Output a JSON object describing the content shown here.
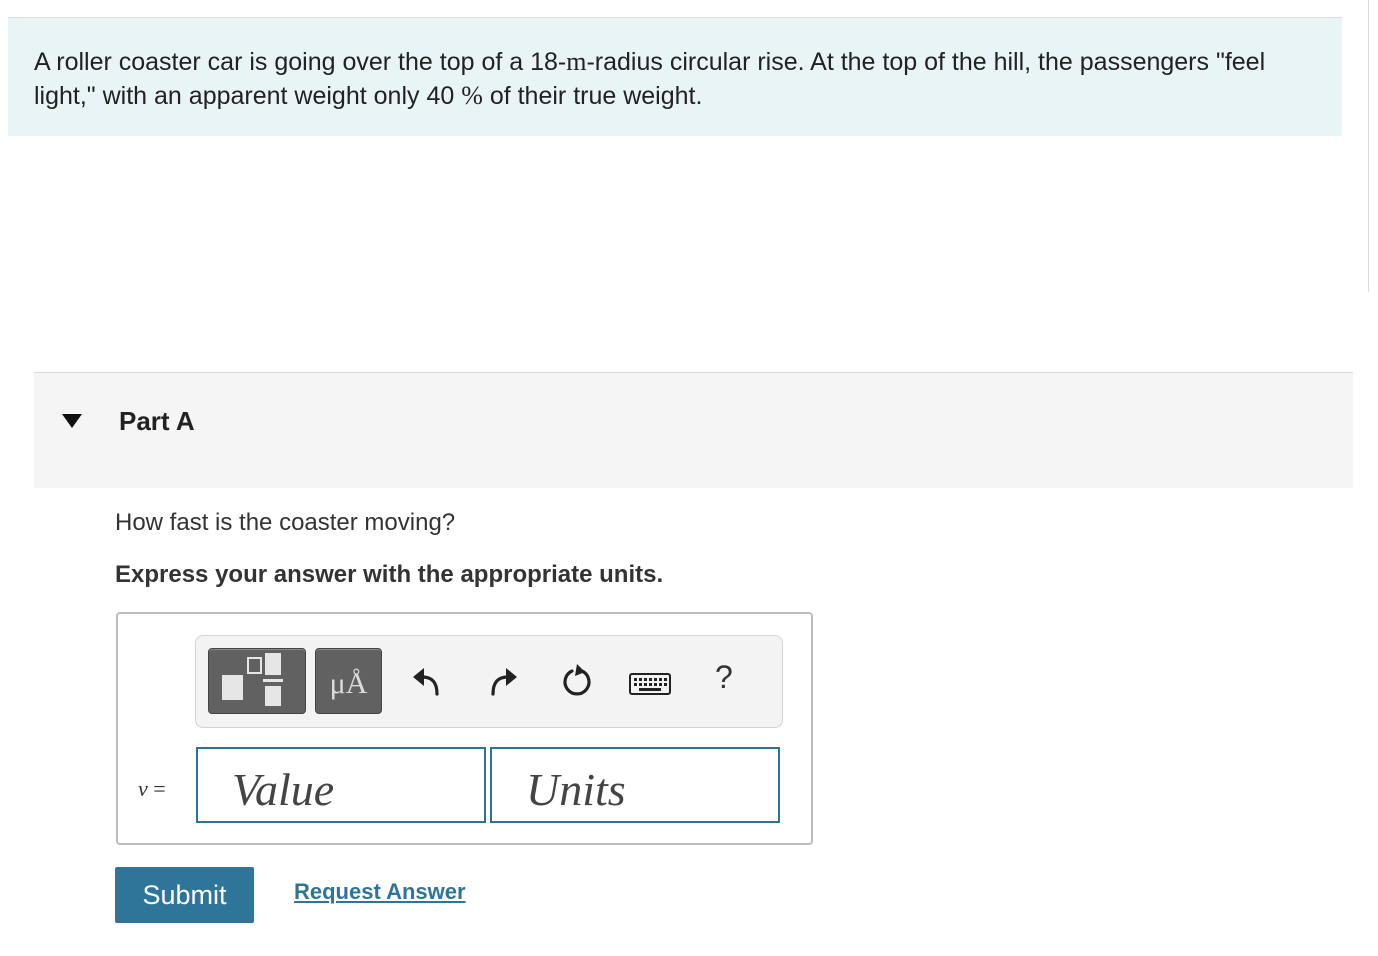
{
  "problem": {
    "text_before_radius": "A roller coaster car is going over the top of a 18-",
    "radius_unit": "m",
    "text_after_radius": "-radius circular rise. At the top of the hill, the passengers \"feel light,\" with an apparent weight only 40 ",
    "percent_symbol": "%",
    "text_end": " of their true weight."
  },
  "part": {
    "title": "Part A",
    "question": "How fast is the coaster moving?",
    "instruction": "Express your answer with the appropriate units."
  },
  "toolbar": {
    "units_button_label": "μÅ",
    "help_label": "?",
    "icons": [
      "templates-icon",
      "units-icon",
      "undo-icon",
      "redo-icon",
      "reset-icon",
      "keyboard-icon",
      "help-icon"
    ]
  },
  "answer": {
    "variable": "v",
    "equals": " =",
    "value_placeholder": "Value",
    "units_placeholder": "Units"
  },
  "actions": {
    "submit_label": "Submit",
    "request_answer_label": "Request Answer"
  },
  "colors": {
    "problem_background": "#e8f4f6",
    "accent": "#2f7599"
  }
}
